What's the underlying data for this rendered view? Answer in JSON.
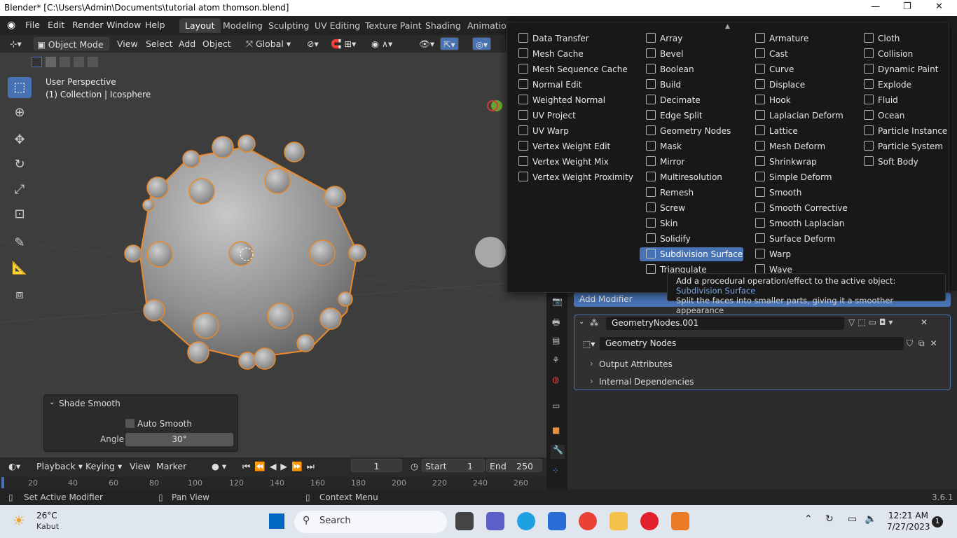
{
  "window": {
    "title": "Blender* [C:\\Users\\Admin\\Documents\\tutorial atom thomson.blend]"
  },
  "menus": [
    "File",
    "Edit",
    "Render",
    "Window",
    "Help"
  ],
  "workspaces": [
    "Layout",
    "Modeling",
    "Sculpting",
    "UV Editing",
    "Texture Paint",
    "Shading",
    "Animation"
  ],
  "header": {
    "mode": "Object Mode",
    "view": "View",
    "select": "Select",
    "add": "Add",
    "object": "Object",
    "transform": "Global"
  },
  "viewport": {
    "perspective": "User Perspective",
    "collection": "(1) Collection | Icosphere"
  },
  "shade_panel": {
    "title": "Shade Smooth",
    "auto_smooth": "Auto Smooth",
    "angle_label": "Angle",
    "angle_value": "30°"
  },
  "timeline": {
    "playback": "Playback",
    "keying": "Keying",
    "view": "View",
    "marker": "Marker",
    "current_frame": "1",
    "start_label": "Start",
    "start": "1",
    "end_label": "End",
    "end": "250",
    "ticks": [
      "20",
      "40",
      "60",
      "80",
      "100",
      "120",
      "140",
      "160",
      "180",
      "200",
      "220",
      "240",
      "260"
    ]
  },
  "statusbar": {
    "left": "Set Active Modifier",
    "middle": "Pan View",
    "right": "Context Menu",
    "version": "3.6.1"
  },
  "modifier_menu": {
    "col1": [
      "Data Transfer",
      "Mesh Cache",
      "Mesh Sequence Cache",
      "Normal Edit",
      "Weighted Normal",
      "UV Project",
      "UV Warp",
      "Vertex Weight Edit",
      "Vertex Weight Mix",
      "Vertex Weight Proximity"
    ],
    "col2": [
      "Array",
      "Bevel",
      "Boolean",
      "Build",
      "Decimate",
      "Edge Split",
      "Geometry Nodes",
      "Mask",
      "Mirror",
      "Multiresolution",
      "Remesh",
      "Screw",
      "Skin",
      "Solidify",
      "Subdivision Surface",
      "Triangulate"
    ],
    "col3": [
      "Armature",
      "Cast",
      "Curve",
      "Displace",
      "Hook",
      "Laplacian Deform",
      "Lattice",
      "Mesh Deform",
      "Shrinkwrap",
      "Simple Deform",
      "Smooth",
      "Smooth Corrective",
      "Smooth Laplacian",
      "Surface Deform",
      "Warp",
      "Wave"
    ],
    "col4": [
      "Cloth",
      "Collision",
      "Dynamic Paint",
      "Explode",
      "Fluid",
      "Ocean",
      "Particle Instance",
      "Particle System",
      "Soft Body"
    ],
    "selected": "Subdivision Surface"
  },
  "tooltip": {
    "line1": "Add a procedural operation/effect to the active object:",
    "highlight": "Subdivision Surface",
    "line2": "Split the faces into smaller parts, giving it a smoother appearance"
  },
  "properties": {
    "add_modifier": "Add Modifier",
    "modifier_name": "GeometryNodes.001",
    "node_group": "Geometry Nodes",
    "output_attrs": "Output Attributes",
    "internal_deps": "Internal Dependencies"
  },
  "taskbar": {
    "temp": "26°C",
    "weather": "Kabut",
    "search": "Search",
    "time": "12:21 AM",
    "date": "7/27/2023",
    "badge": "1"
  }
}
